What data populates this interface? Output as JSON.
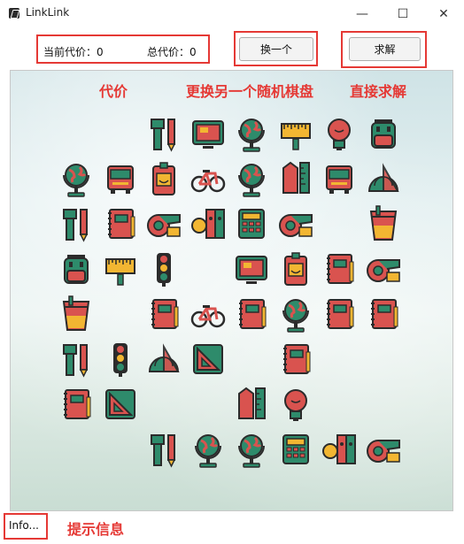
{
  "window": {
    "title": "LinkLink",
    "minimize_glyph": "—",
    "maximize_glyph": "☐",
    "close_glyph": "✕"
  },
  "toolbar": {
    "current_cost_label": "当前代价：0",
    "total_cost_label": "总代价：0",
    "shuffle_button": "换一个",
    "solve_button": "求解"
  },
  "annotations": {
    "cost": "代价",
    "shuffle": "更换另一个随机棋盘",
    "solve": "直接求解",
    "info": "提示信息"
  },
  "status": {
    "info_text": "Info..."
  },
  "colors": {
    "accent_red": "#e53935",
    "icon_red": "#d9534f",
    "icon_green": "#2e8b6b",
    "icon_yellow": "#f2b632"
  },
  "board": {
    "rows": [
      [
        "",
        "",
        "tool",
        "tablet",
        "globe",
        "ruler-board",
        "bulb",
        "backpack"
      ],
      [
        "globe",
        "bus",
        "id-badge",
        "bicycle",
        "globe",
        "pen-ruler",
        "bus",
        "protractor"
      ],
      [
        "tool",
        "notebook",
        "tape",
        "binders",
        "calculator",
        "tape",
        "",
        "cup"
      ],
      [
        "backpack",
        "ruler-board",
        "traffic-light",
        "",
        "tablet",
        "id-badge",
        "notebook",
        "tape"
      ],
      [
        "cup",
        "",
        "notebook",
        "bicycle",
        "notebook",
        "globe",
        "notebook",
        "notebook"
      ],
      [
        "tool",
        "traffic-light",
        "protractor",
        "triangle-ruler",
        "",
        "notebook",
        "",
        ""
      ],
      [
        "notebook",
        "triangle-ruler",
        "",
        "",
        "pen-ruler",
        "bulb",
        "",
        ""
      ],
      [
        "",
        "",
        "tool",
        "globe",
        "globe",
        "calculator",
        "binders",
        "tape"
      ]
    ]
  }
}
